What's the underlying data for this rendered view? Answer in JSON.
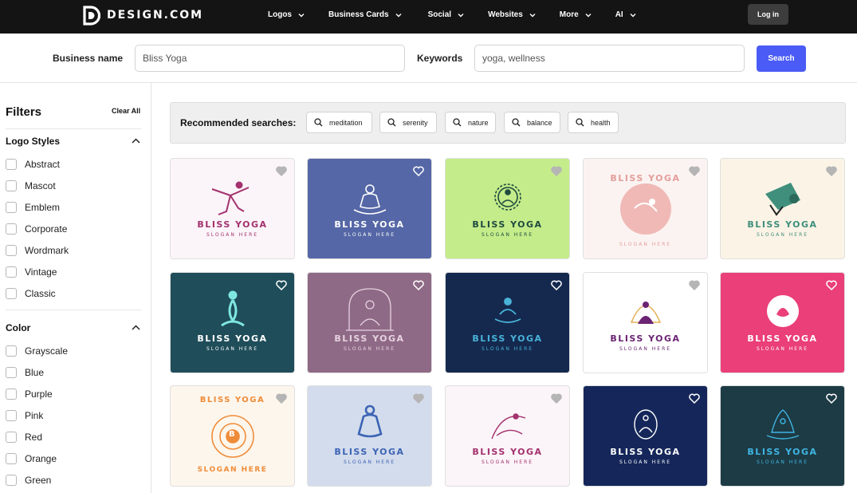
{
  "brand": {
    "name": "DESIGN.COM"
  },
  "nav": {
    "items": [
      {
        "label": "Logos"
      },
      {
        "label": "Business Cards"
      },
      {
        "label": "Social"
      },
      {
        "label": "Websites"
      },
      {
        "label": "More"
      },
      {
        "label": "AI"
      }
    ],
    "login_label": "Log in"
  },
  "search": {
    "business_label": "Business name",
    "business_value": "Bliss Yoga",
    "keywords_label": "Keywords",
    "keywords_value": "yoga, wellness",
    "search_label": "Search"
  },
  "filters": {
    "title": "Filters",
    "clear_label": "Clear All",
    "logo_styles": {
      "title": "Logo Styles",
      "options": [
        "Abstract",
        "Mascot",
        "Emblem",
        "Corporate",
        "Wordmark",
        "Vintage",
        "Classic"
      ]
    },
    "color": {
      "title": "Color",
      "options": [
        "Grayscale",
        "Blue",
        "Purple",
        "Pink",
        "Red",
        "Orange",
        "Green"
      ]
    }
  },
  "recommended": {
    "label": "Recommended searches:",
    "chips": [
      "meditation",
      "serenity",
      "nature",
      "balance",
      "health"
    ]
  },
  "logos": [
    {
      "name": "BLISS YOGA",
      "slogan": "SLOGAN HERE",
      "bg": "#fbf4f9",
      "fg": "#a3326e",
      "icon": "yoga-pose-icon"
    },
    {
      "name": "BLISS YOGA",
      "slogan": "SLOGAN HERE",
      "bg": "#5567a6",
      "fg": "#ffffff",
      "icon": "meditation-icon"
    },
    {
      "name": "BLISS YOGA",
      "slogan": "SLOGAN HERE",
      "bg": "#c4ec8a",
      "fg": "#1f4a3f",
      "icon": "sun-meditation-icon"
    },
    {
      "name": "BLISS YOGA",
      "slogan": "SLOGAN HERE",
      "bg": "#fbf3f2",
      "fg": "#e39e9a",
      "icon": "circle-badge-icon"
    },
    {
      "name": "BLISS YOGA",
      "slogan": "SLOGAN HERE",
      "bg": "#fbf3e6",
      "fg": "#3f8f7c",
      "icon": "yoga-mat-icon"
    },
    {
      "name": "BLISS YOGA",
      "slogan": "SLOGAN HERE",
      "bg": "#1f4d5a",
      "fg": "#ffffff",
      "icon": "figure-icon"
    },
    {
      "name": "BLISS YOGA",
      "slogan": "SLOGAN HERE",
      "bg": "#8f6a86",
      "fg": "#e6d2df",
      "icon": "arch-meditation-icon"
    },
    {
      "name": "BLISS YOGA",
      "slogan": "SLOGAN HERE",
      "bg": "#15294f",
      "fg": "#49b3d9",
      "icon": "lotus-meditation-icon"
    },
    {
      "name": "BLISS YOGA",
      "slogan": "SLOGAN HERE",
      "bg": "#ffffff",
      "fg": "#6b2473",
      "icon": "lotus-figure-icon"
    },
    {
      "name": "BLISS YOGA",
      "slogan": "SLOGAN HERE",
      "bg": "#ea3f79",
      "fg": "#ffffff",
      "icon": "circle-lotus-icon"
    },
    {
      "name": "",
      "slogan": "",
      "bg": "#fdf6ec",
      "fg": "#ef8c3a",
      "icon": "mandala-badge-icon",
      "badge_top": "BLISS YOGA",
      "badge_bottom": "SLOGAN HERE",
      "badge_letter": "B"
    },
    {
      "name": "BLISS YOGA",
      "slogan": "SLOGAN HERE",
      "bg": "#d3dcec",
      "fg": "#3c64b5",
      "icon": "outline-meditation-icon"
    },
    {
      "name": "BLISS YOGA",
      "slogan": "SLOGAN HERE",
      "bg": "#fbf4f8",
      "fg": "#a3326e",
      "icon": "leaf-pose-icon"
    },
    {
      "name": "BLISS YOGA",
      "slogan": "SLOGAN HERE",
      "bg": "#15275a",
      "fg": "#ffffff",
      "icon": "oval-meditation-icon"
    },
    {
      "name": "BLISS YOGA",
      "slogan": "SLOGAN HERE",
      "bg": "#1d3b45",
      "fg": "#3fb5e3",
      "icon": "lotus-outline-icon"
    }
  ]
}
